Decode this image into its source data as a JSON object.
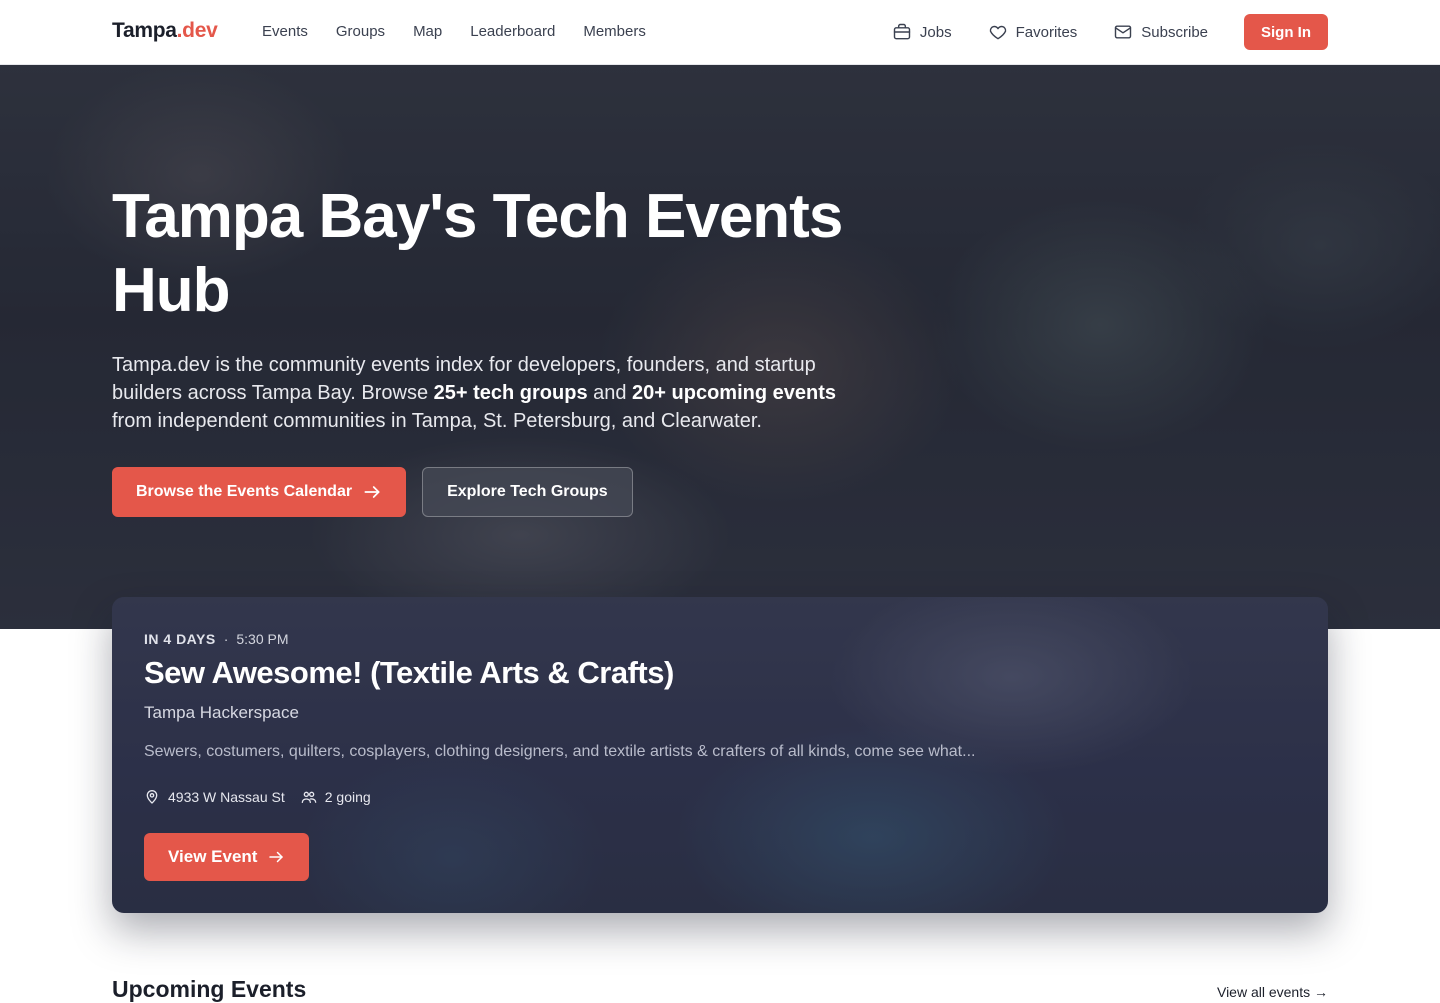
{
  "nav": {
    "brand_main": "Tampa",
    "brand_accent": ".dev",
    "links": [
      "Events",
      "Groups",
      "Map",
      "Leaderboard",
      "Members"
    ],
    "actions": {
      "jobs": "Jobs",
      "favorites": "Favorites",
      "subscribe": "Subscribe"
    },
    "signin": "Sign In"
  },
  "hero": {
    "title": "Tampa Bay's Tech Events Hub",
    "desc_part1": "Tampa.dev is the community events index for developers, founders, and startup builders across Tampa Bay. Browse ",
    "desc_bold1": "25+ tech groups",
    "desc_part2": " and ",
    "desc_bold2": "20+ upcoming events",
    "desc_part3": " from independent communities in Tampa, St. Petersburg, and Clearwater.",
    "primary_button": "Browse the Events Calendar",
    "secondary_button": "Explore Tech Groups"
  },
  "featured": {
    "when": "IN 4 DAYS",
    "separator": "·",
    "time": "5:30 PM",
    "title": "Sew Awesome! (Textile Arts & Crafts)",
    "organizer": "Tampa Hackerspace",
    "description": "Sewers, costumers, quilters, cosplayers, clothing designers, and textile artists & crafters of all kinds, come see what...",
    "address": "4933 W Nassau St",
    "going": "2 going",
    "button": "View Event"
  },
  "upcoming": {
    "title": "Upcoming Events",
    "view_all": "View all events →"
  },
  "colors": {
    "accent": "#e4574a",
    "hero_overlay": "#2d313d",
    "text_dark": "#1b1f2a"
  }
}
